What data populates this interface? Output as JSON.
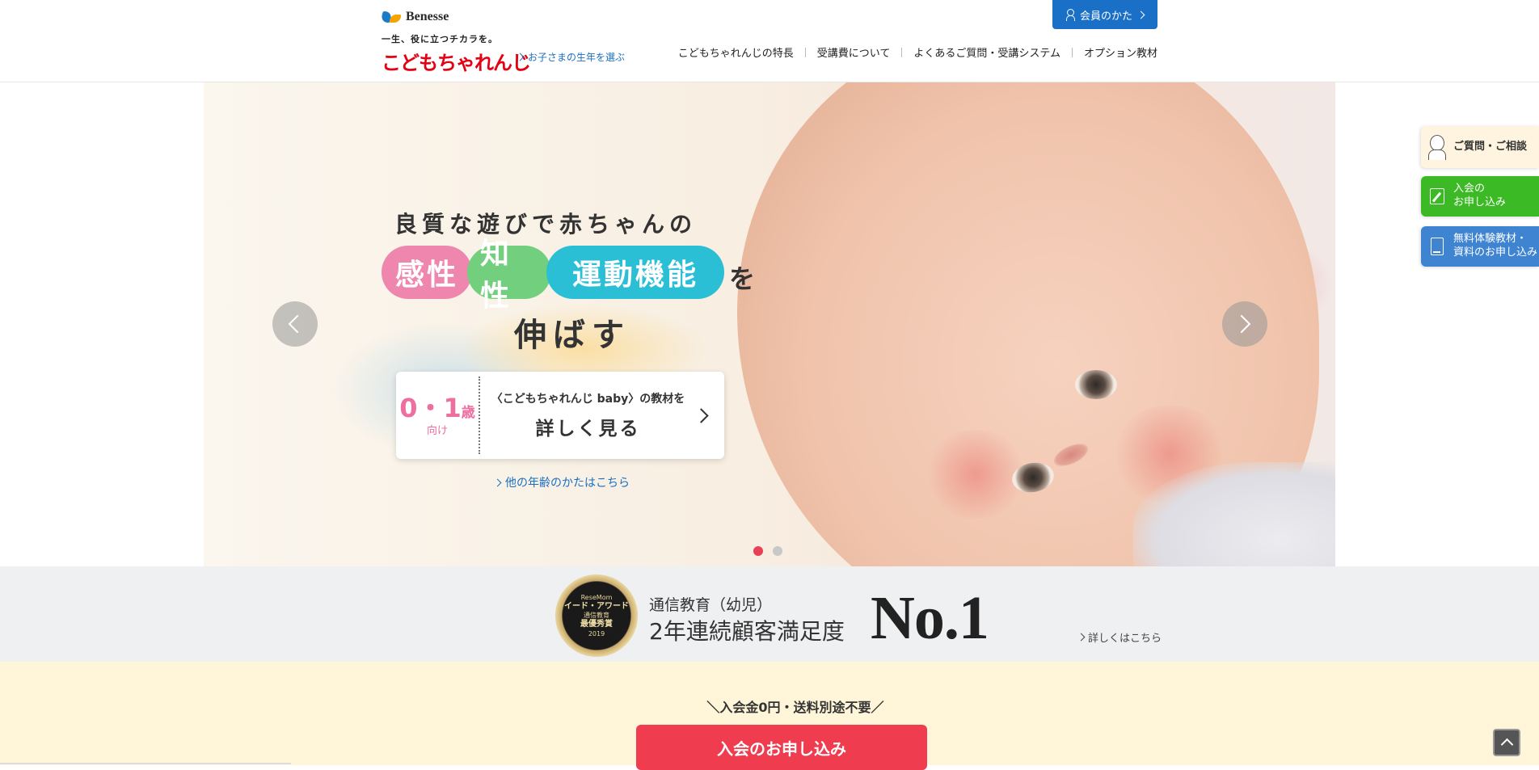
{
  "header": {
    "corporate_logo": "Benesse",
    "tagline": "一生、役に立つチカラを。",
    "logo": "こどもちゃれんじ",
    "year_select_link": "お子さまの生年を選ぶ",
    "member_button": "会員のかた",
    "nav": [
      "こどもちゃれんじの特長",
      "受講費について",
      "よくあるご質問・受講システム",
      "オプション教材"
    ]
  },
  "hero": {
    "line1": "良質な遊びで赤ちゃんの",
    "pills": [
      "感性",
      "知性",
      "運動機能"
    ],
    "particle": "を",
    "line3": "伸ばす",
    "card": {
      "age_number": "0・1",
      "age_unit": "歳",
      "age_suffix": "向け",
      "subtitle": "〈こどもちゃれんじ baby〉の教材を",
      "title": "詳しく見る"
    },
    "other_age_link": "他の年齢のかたはこちら",
    "slide_count": 2,
    "active_slide": 1
  },
  "side_tabs": {
    "contact": "ご質問・ご相談",
    "apply_line1": "入会の",
    "apply_line2": "お申し込み",
    "trial_line1": "無料体験教材・",
    "trial_line2": "資料のお申し込み"
  },
  "award": {
    "medal_line1": "ReseMom",
    "medal_line2": "イード・アワード",
    "medal_line3": "通信教育",
    "medal_line4": "最優秀賞",
    "medal_year": "2019",
    "subtitle": "通信教育（幼児）",
    "main": "2年連続顧客満足度",
    "rank": "No.1",
    "detail_link": "詳しくはこちら"
  },
  "join": {
    "note": "＼入会金0円・送料別途不要／",
    "button": "入会のお申し込み"
  },
  "colors": {
    "brand_red": "#e50012",
    "member_blue": "#1a6fc7",
    "pill_pink": "#ee86ae",
    "pill_green": "#72cf7e",
    "pill_cyan": "#2bbfd6",
    "join_red": "#ef3c4f",
    "side_green": "#3cba26",
    "side_blue": "#3f84d1"
  }
}
